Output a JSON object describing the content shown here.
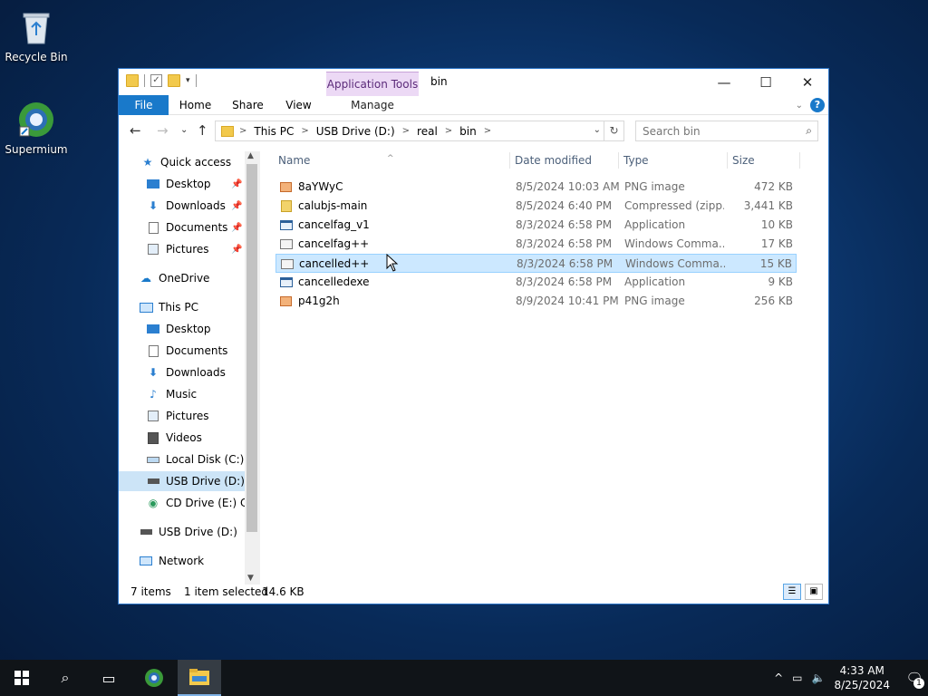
{
  "desktop": {
    "icons": [
      {
        "label": "Recycle Bin"
      },
      {
        "label": "Supermium"
      }
    ]
  },
  "window": {
    "title": "bin",
    "context_tab_group": "Application Tools",
    "context_tab": "Manage",
    "ribbon_tabs": [
      "File",
      "Home",
      "Share",
      "View"
    ],
    "help_glyph": "?"
  },
  "address": {
    "segments": [
      "This PC",
      "USB Drive (D:)",
      "real",
      "bin"
    ],
    "search_placeholder": "Search bin"
  },
  "nav": {
    "items": [
      {
        "label": "Quick access",
        "icon": "star-icon",
        "pinned": false
      },
      {
        "label": "Desktop",
        "icon": "desktop-icon",
        "pinned": true
      },
      {
        "label": "Downloads",
        "icon": "download-icon",
        "pinned": true
      },
      {
        "label": "Documents",
        "icon": "documents-icon",
        "pinned": true
      },
      {
        "label": "Pictures",
        "icon": "pictures-icon",
        "pinned": true
      },
      {
        "label": "OneDrive",
        "icon": "cloud-icon"
      },
      {
        "label": "This PC",
        "icon": "computer-icon"
      },
      {
        "label": "Desktop",
        "icon": "desktop-icon"
      },
      {
        "label": "Documents",
        "icon": "documents-icon"
      },
      {
        "label": "Downloads",
        "icon": "download-icon"
      },
      {
        "label": "Music",
        "icon": "music-icon"
      },
      {
        "label": "Pictures",
        "icon": "pictures-icon"
      },
      {
        "label": "Videos",
        "icon": "videos-icon"
      },
      {
        "label": "Local Disk (C:)",
        "icon": "disk-icon"
      },
      {
        "label": "USB Drive (D:)",
        "icon": "usb-drive-icon",
        "selected": true
      },
      {
        "label": "CD Drive (E:) CC",
        "icon": "cd-drive-icon"
      },
      {
        "label": "USB Drive (D:)",
        "icon": "usb-drive-icon"
      },
      {
        "label": "Network",
        "icon": "network-icon"
      }
    ]
  },
  "list": {
    "columns": {
      "name": "Name",
      "date": "Date modified",
      "type": "Type",
      "size": "Size"
    },
    "rows": [
      {
        "name": "8aYWyC",
        "date": "8/5/2024 10:03 AM",
        "type": "PNG image",
        "size": "472 KB",
        "icon": "png-icon"
      },
      {
        "name": "calubjs-main",
        "date": "8/5/2024 6:40 PM",
        "type": "Compressed (zipp...",
        "size": "3,441 KB",
        "icon": "zip-icon"
      },
      {
        "name": "cancelfag_v1",
        "date": "8/3/2024 6:58 PM",
        "type": "Application",
        "size": "10 KB",
        "icon": "app-icon"
      },
      {
        "name": "cancelfag++",
        "date": "8/3/2024 6:58 PM",
        "type": "Windows Comma...",
        "size": "17 KB",
        "icon": "cmd-icon"
      },
      {
        "name": "cancelled++",
        "date": "8/3/2024 6:58 PM",
        "type": "Windows Comma...",
        "size": "15 KB",
        "icon": "cmd-icon",
        "selected": true
      },
      {
        "name": "cancelledexe",
        "date": "8/3/2024 6:58 PM",
        "type": "Application",
        "size": "9 KB",
        "icon": "app-icon"
      },
      {
        "name": "p41g2h",
        "date": "8/9/2024 10:41 PM",
        "type": "PNG image",
        "size": "256 KB",
        "icon": "png-icon"
      }
    ]
  },
  "status": {
    "count": "7 items",
    "selection": "1 item selected",
    "size": "14.6 KB"
  },
  "taskbar": {
    "time": "4:33 AM",
    "date": "8/25/2024",
    "notification_count": "1"
  }
}
